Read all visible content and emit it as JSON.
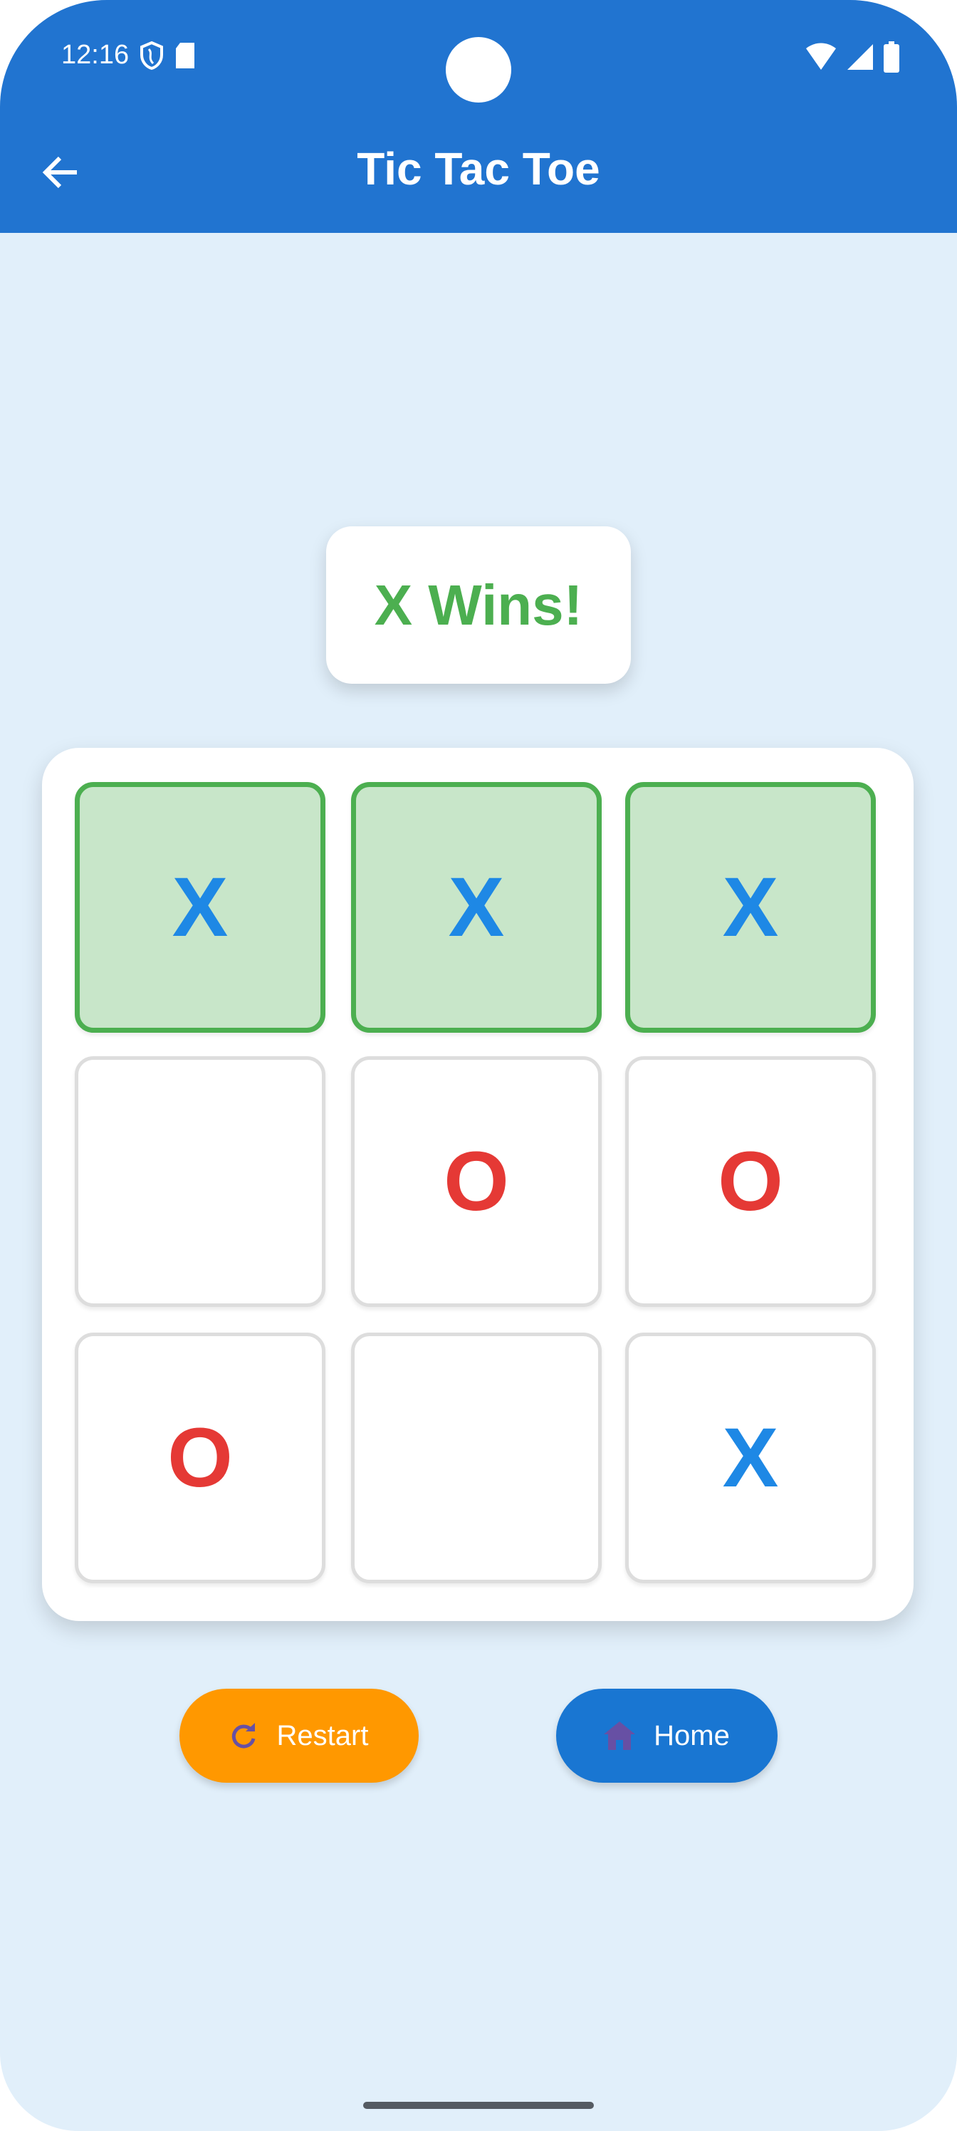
{
  "status_bar": {
    "time": "12:16"
  },
  "app_bar": {
    "title": "Tic Tac Toe"
  },
  "game": {
    "status": "X Wins!",
    "board": [
      "X",
      "X",
      "X",
      "",
      "O",
      "O",
      "O",
      "",
      "X"
    ],
    "winning_cells": [
      0,
      1,
      2
    ]
  },
  "buttons": {
    "restart": "Restart",
    "home": "Home"
  },
  "colors": {
    "app_bar": "#2174d0",
    "background": "#e1effa",
    "win": "#4caf50",
    "x": "#1e88e5",
    "o": "#e53935",
    "restart": "#ff9800",
    "home": "#1976d2"
  }
}
